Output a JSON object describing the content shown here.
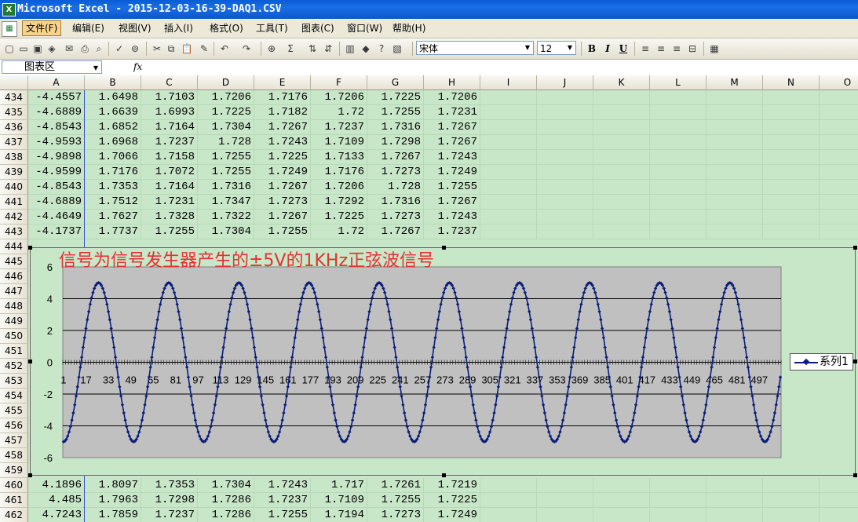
{
  "window": {
    "title": "Microsoft Excel - 2015-12-03-16-39-DAQ1.CSV"
  },
  "menu": [
    "文件(F)",
    "编辑(E)",
    "视图(V)",
    "插入(I)",
    "格式(O)",
    "工具(T)",
    "图表(C)",
    "窗口(W)",
    "帮助(H)"
  ],
  "toolbar": {
    "font_name": "宋体",
    "font_size": "12",
    "bold": "B",
    "italic": "I",
    "underline": "U",
    "sum": "Σ"
  },
  "formula_bar": {
    "name_box": "图表区",
    "fx": "fx"
  },
  "columns": [
    "A",
    "B",
    "C",
    "D",
    "E",
    "F",
    "G",
    "H",
    "I",
    "J",
    "K",
    "L",
    "M",
    "N",
    "O"
  ],
  "rows_top": [
    {
      "num": "434",
      "cells": [
        "-4.4557",
        "1.6498",
        "1.7103",
        "1.7206",
        "1.7176",
        "1.7206",
        "1.7225",
        "1.7206"
      ]
    },
    {
      "num": "435",
      "cells": [
        "-4.6889",
        "1.6639",
        "1.6993",
        "1.7225",
        "1.7182",
        "1.72",
        "1.7255",
        "1.7231"
      ]
    },
    {
      "num": "436",
      "cells": [
        "-4.8543",
        "1.6852",
        "1.7164",
        "1.7304",
        "1.7267",
        "1.7237",
        "1.7316",
        "1.7267"
      ]
    },
    {
      "num": "437",
      "cells": [
        "-4.9593",
        "1.6968",
        "1.7237",
        "1.728",
        "1.7243",
        "1.7109",
        "1.7298",
        "1.7267"
      ]
    },
    {
      "num": "438",
      "cells": [
        "-4.9898",
        "1.7066",
        "1.7158",
        "1.7255",
        "1.7225",
        "1.7133",
        "1.7267",
        "1.7243"
      ]
    },
    {
      "num": "439",
      "cells": [
        "-4.9599",
        "1.7176",
        "1.7072",
        "1.7255",
        "1.7249",
        "1.7176",
        "1.7273",
        "1.7249"
      ]
    },
    {
      "num": "440",
      "cells": [
        "-4.8543",
        "1.7353",
        "1.7164",
        "1.7316",
        "1.7267",
        "1.7206",
        "1.728",
        "1.7255"
      ]
    },
    {
      "num": "441",
      "cells": [
        "-4.6889",
        "1.7512",
        "1.7231",
        "1.7347",
        "1.7273",
        "1.7292",
        "1.7316",
        "1.7267"
      ]
    },
    {
      "num": "442",
      "cells": [
        "-4.4649",
        "1.7627",
        "1.7328",
        "1.7322",
        "1.7267",
        "1.7225",
        "1.7273",
        "1.7243"
      ]
    },
    {
      "num": "443",
      "cells": [
        "-4.1737",
        "1.7737",
        "1.7255",
        "1.7304",
        "1.7255",
        "1.72",
        "1.7267",
        "1.7237"
      ]
    }
  ],
  "rows_hidden_nums": [
    "444",
    "445",
    "446",
    "447",
    "448",
    "449",
    "450",
    "451",
    "452",
    "453",
    "454",
    "455",
    "456",
    "457",
    "458",
    "459"
  ],
  "rows_bottom": [
    {
      "num": "460",
      "cells": [
        "4.1896",
        "1.8097",
        "1.7353",
        "1.7304",
        "1.7243",
        "1.717",
        "1.7261",
        "1.7219"
      ]
    },
    {
      "num": "461",
      "cells": [
        "4.485",
        "1.7963",
        "1.7298",
        "1.7286",
        "1.7237",
        "1.7109",
        "1.7255",
        "1.7225"
      ]
    },
    {
      "num": "462",
      "cells": [
        "4.7243",
        "1.7859",
        "1.7237",
        "1.7286",
        "1.7255",
        "1.7194",
        "1.7273",
        "1.7249"
      ]
    }
  ],
  "chart_data": {
    "type": "line",
    "title": "信号为信号发生器产生的±5V的1KHz正弦波信号",
    "xlabel": "",
    "ylabel": "",
    "ylim": [
      -6,
      6
    ],
    "yticks": [
      -6,
      -4,
      -2,
      0,
      2,
      4,
      6
    ],
    "x_tick_labels": [
      "1",
      "17",
      "33",
      "49",
      "65",
      "81",
      "97",
      "113",
      "129",
      "145",
      "161",
      "177",
      "193",
      "209",
      "225",
      "241",
      "257",
      "273",
      "289",
      "305",
      "321",
      "337",
      "353",
      "369",
      "385",
      "401",
      "417",
      "433",
      "449",
      "465",
      "481",
      "497"
    ],
    "grid": true,
    "legend": "right",
    "series": [
      {
        "name": "系列1",
        "amplitude": 5.0,
        "period_samples": 50,
        "n_points": 512,
        "start_phase": "minimum",
        "color": "#0a1e78"
      }
    ],
    "plot_background": "#c0c0c0"
  }
}
